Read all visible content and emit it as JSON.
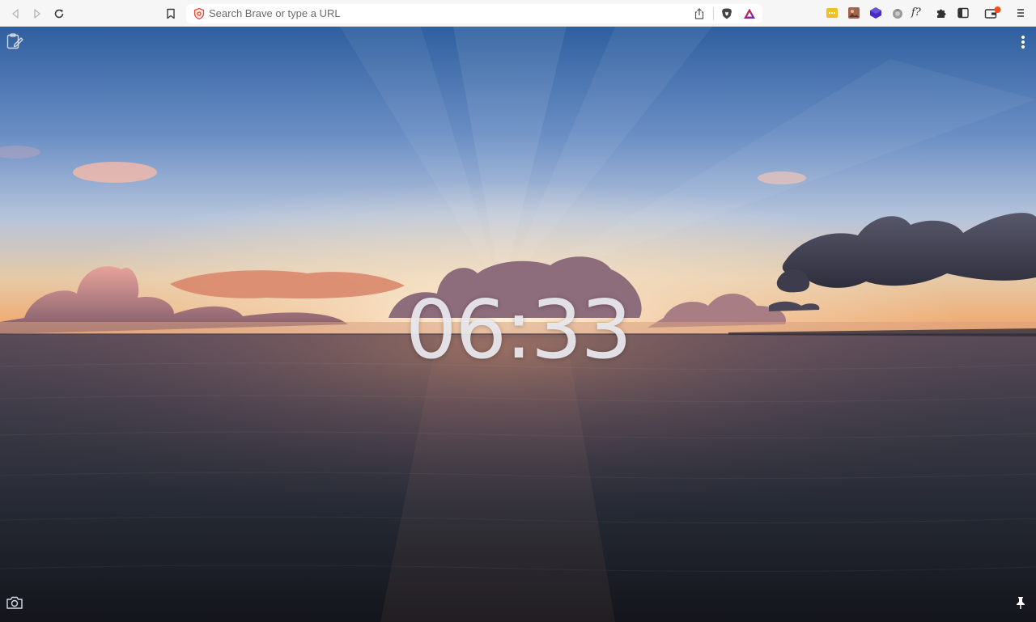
{
  "toolbar": {
    "address_placeholder": "Search Brave or type a URL",
    "icons": {
      "back": "back-arrow-icon",
      "forward": "forward-arrow-icon",
      "reload": "reload-icon",
      "bookmark": "bookmark-icon",
      "site_shield": "site-shield-icon",
      "share": "share-icon",
      "brave_shields": "brave-lion-icon",
      "brave_rewards": "rewards-triangle-icon",
      "extensions": [
        "yellow-note-extension-icon",
        "brown-photo-extension-icon",
        "purple-cube-extension-icon",
        "tomato-timer-extension-icon",
        "function-extension-icon"
      ],
      "ext_function_label": "f?",
      "puzzle": "puzzle-extensions-icon",
      "sidebar": "sidebar-icon",
      "wallet": "wallet-icon",
      "menu": "hamburger-menu-icon"
    },
    "colors": {
      "toolbar_bg": "#f6f6f6",
      "wallet_badge": "#ff4a1a",
      "yellow_ext": "#f4c020",
      "purple_ext": "#4a2cc4",
      "rewards_red": "#e0202b"
    }
  },
  "page": {
    "clock": "06:33",
    "icons": {
      "notes": "notepad-pencil-icon",
      "more": "vertical-ellipsis-icon",
      "camera": "camera-icon",
      "pin": "pin-icon"
    }
  }
}
